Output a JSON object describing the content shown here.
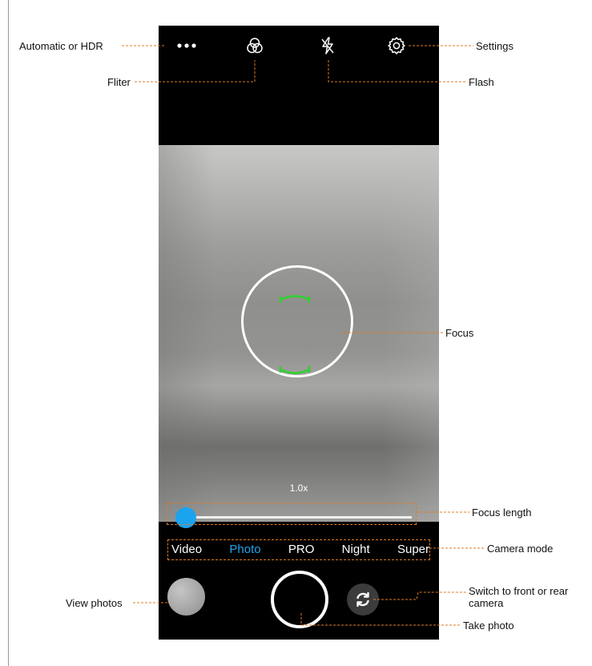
{
  "callouts": {
    "hdr": "Automatic or HDR",
    "filter": "Fliter",
    "flash": "Flash",
    "settings": "Settings",
    "focus": "Focus",
    "focus_length": "Focus length",
    "camera_mode": "Camera mode",
    "view_photos": "View photos",
    "switch_camera_line1": "Switch to front or rear",
    "switch_camera_line2": "camera",
    "take_photo": "Take photo"
  },
  "topbar": {
    "icons": [
      "more-dots-icon",
      "filter-icon",
      "flash-off-icon",
      "settings-gear-icon"
    ]
  },
  "viewfinder": {
    "zoom_label": "1.0x",
    "zoom_level_fraction": 0.0,
    "focus_indicator_color": "#2fd12f"
  },
  "modes": {
    "items": [
      "Video",
      "Photo",
      "PRO",
      "Night",
      "Super"
    ],
    "active": "Photo"
  },
  "colors": {
    "accent": "#1da5f0",
    "annotation": "#e07b22",
    "phone_background": "#000000"
  },
  "bottom": {
    "icons": [
      "gallery-thumbnail",
      "shutter-button",
      "switch-camera-icon"
    ]
  }
}
